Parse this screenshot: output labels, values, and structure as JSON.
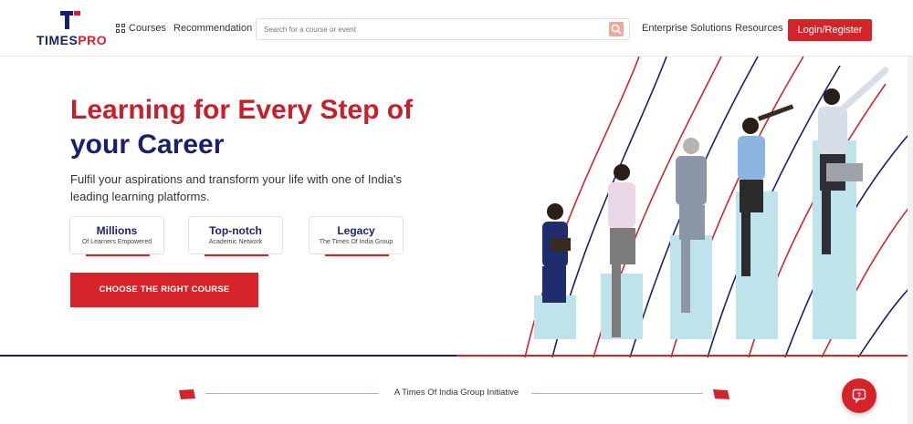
{
  "brand": {
    "logo_text_times": "TIMES",
    "logo_text_pro": "PRO"
  },
  "nav": {
    "courses": "Courses",
    "recommendation": "Recommendation",
    "enterprise": "Enterprise Solutions",
    "resources": "Resources",
    "login": "Login/Register"
  },
  "search": {
    "placeholder": "Search for a course or event"
  },
  "hero": {
    "title_line1": "Learning for Every Step of",
    "title_line2": "your Career",
    "subtitle": "Fulfil your aspirations and transform your life with one of India's leading learning platforms.",
    "stats": [
      {
        "title": "Millions",
        "sub": "Of Learners Empowered"
      },
      {
        "title": "Top-notch",
        "sub": "Academic Network"
      },
      {
        "title": "Legacy",
        "sub": "The Times Of India Group"
      }
    ],
    "cta": "CHOOSE THE RIGHT COURSE"
  },
  "initiative": "A Times Of India Group Initiative",
  "colors": {
    "brand_red": "#d4242a",
    "brand_navy": "#1a1f6e",
    "pillar": "#bfe3ea"
  },
  "icons": {
    "search": "search-icon",
    "grid": "grid-icon",
    "help": "help-chat-icon",
    "flag": "flag-icon"
  }
}
